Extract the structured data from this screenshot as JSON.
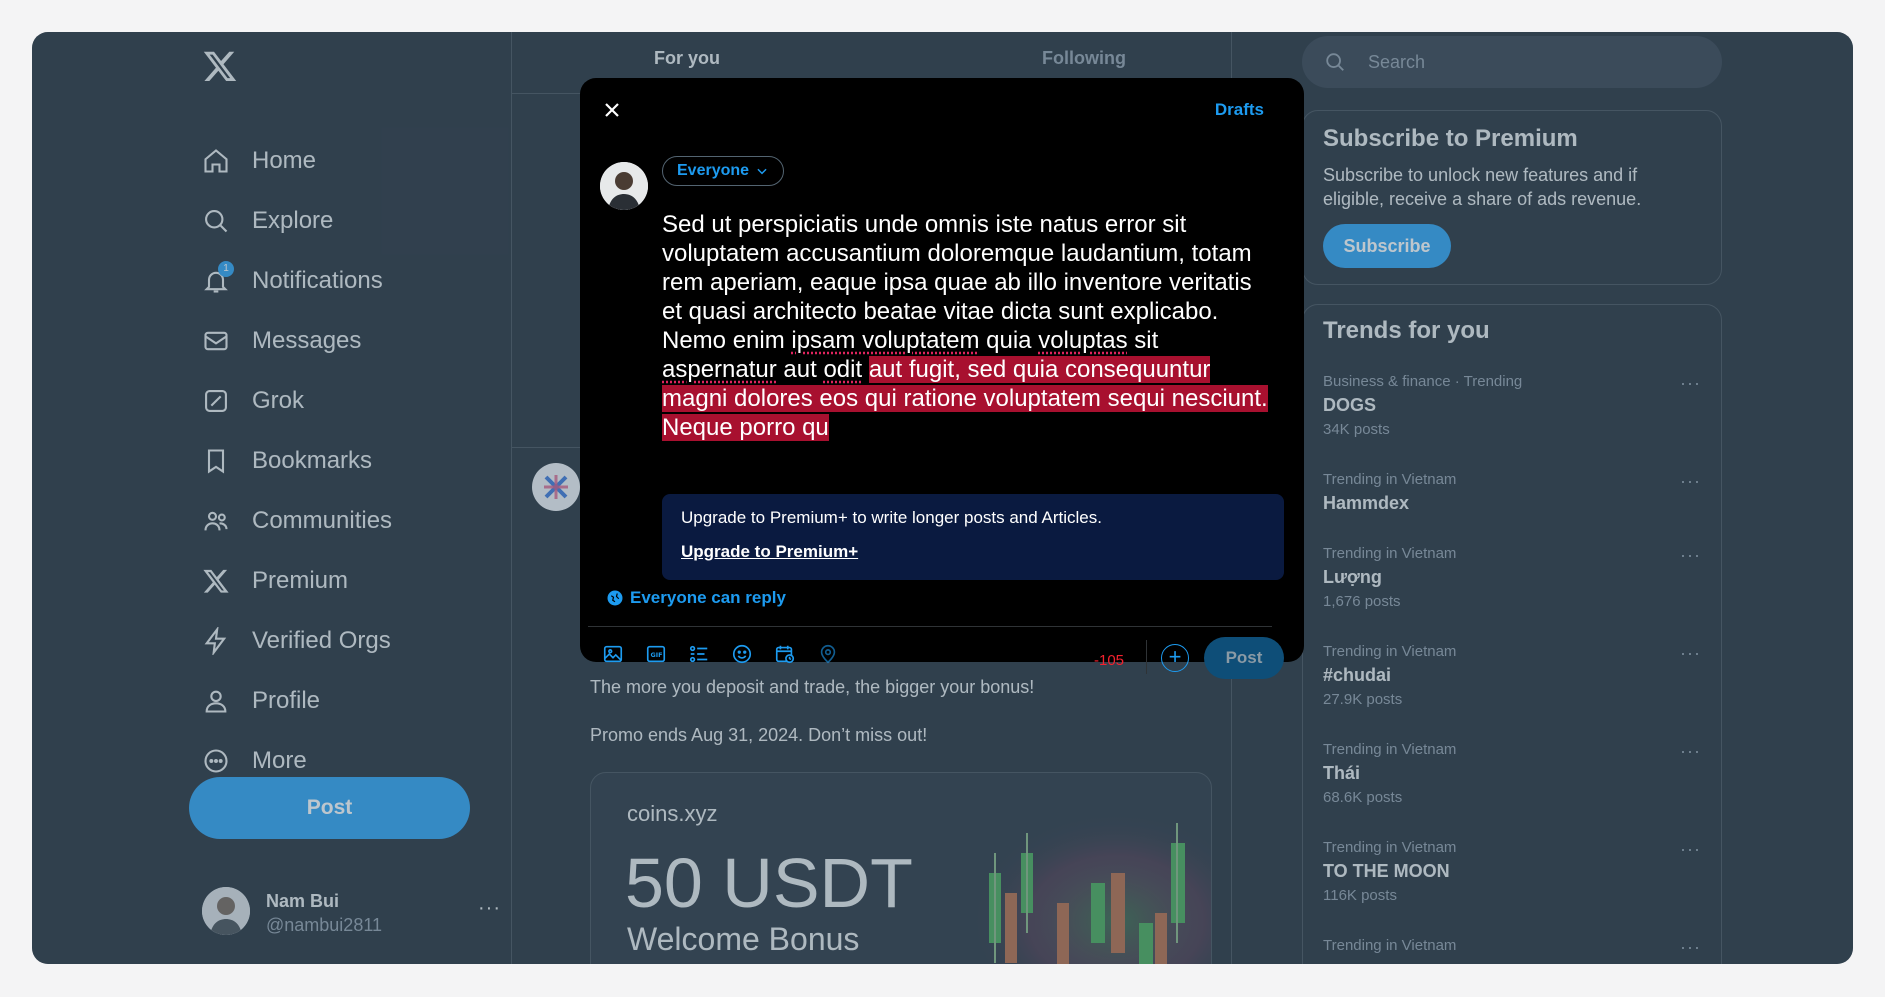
{
  "nav": {
    "items": [
      {
        "label": "Home",
        "icon": "home-icon"
      },
      {
        "label": "Explore",
        "icon": "search-icon"
      },
      {
        "label": "Notifications",
        "icon": "bell-icon",
        "badge": "1"
      },
      {
        "label": "Messages",
        "icon": "envelope-icon"
      },
      {
        "label": "Grok",
        "icon": "grok-icon"
      },
      {
        "label": "Bookmarks",
        "icon": "bookmark-icon"
      },
      {
        "label": "Communities",
        "icon": "people-icon"
      },
      {
        "label": "Premium",
        "icon": "x-logo-icon"
      },
      {
        "label": "Verified Orgs",
        "icon": "lightning-icon"
      },
      {
        "label": "Profile",
        "icon": "person-icon"
      },
      {
        "label": "More",
        "icon": "more-circle-icon"
      }
    ],
    "post_label": "Post",
    "account": {
      "name": "Nam Bui",
      "handle": "@nambui2811",
      "more": "···"
    }
  },
  "center": {
    "tabs": [
      "For you",
      "Following"
    ],
    "promo_lines": [
      "The more you deposit and trade, the bigger your bonus!",
      "Promo ends Aug 31, 2024. Don’t miss out!"
    ],
    "card": {
      "brand": "coins.xyz",
      "headline": "50 USDT",
      "subline": "Welcome Bonus"
    }
  },
  "right": {
    "search_placeholder": "Search",
    "premium": {
      "title": "Subscribe to Premium",
      "description": "Subscribe to unlock new features and if eligible, receive a share of ads revenue.",
      "button": "Subscribe"
    },
    "trends_title": "Trends for you",
    "trends": [
      {
        "context": "Business & finance · Trending",
        "name": "DOGS",
        "count": "34K posts"
      },
      {
        "context": "Trending in Vietnam",
        "name": "Hammdex",
        "count": ""
      },
      {
        "context": "Trending in Vietnam",
        "name": "Lượng",
        "count": "1,676 posts"
      },
      {
        "context": "Trending in Vietnam",
        "name": "#chudai",
        "count": "27.9K posts"
      },
      {
        "context": "Trending in Vietnam",
        "name": "Thái",
        "count": "68.6K posts"
      },
      {
        "context": "Trending in Vietnam",
        "name": "TO THE MOON",
        "count": "116K posts"
      },
      {
        "context": "Trending in Vietnam",
        "name": "",
        "count": ""
      }
    ]
  },
  "composer": {
    "drafts": "Drafts",
    "audience": "Everyone",
    "text_main": "Sed ut perspiciatis unde omnis iste natus error sit voluptatem accusantium doloremque laudantium, totam rem aperiam, eaque ipsa quae ab illo inventore veritatis et quasi architecto beatae vitae dicta sunt explicabo. Nemo enim ",
    "text_ul1": "ipsam voluptatem",
    "text_mid1": " quia ",
    "text_ul2": "voluptas",
    "text_mid2": " sit ",
    "text_ul3": "aspernatur",
    "text_mid3": " aut ",
    "text_ul4": "odit",
    "text_mid4": " ",
    "text_over": "aut fugit, sed quia consequuntur magni dolores eos qui ratione voluptatem sequi nesciunt. Neque porro qu",
    "upgrade_text": "Upgrade to Premium+ to write longer posts and Articles.",
    "upgrade_link": "Upgrade to Premium+",
    "reply_setting": "Everyone can reply",
    "char_count": "-105",
    "post_label": "Post",
    "plus": "+"
  }
}
